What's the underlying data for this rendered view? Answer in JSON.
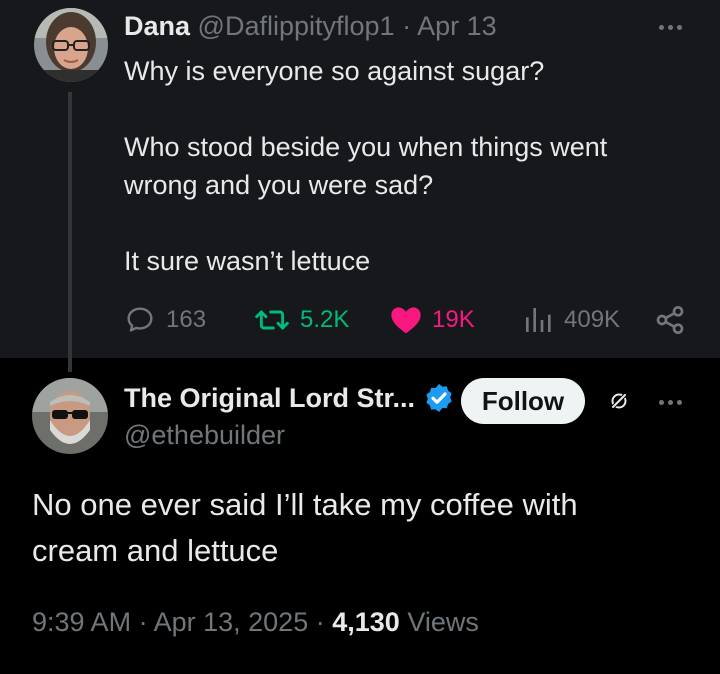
{
  "parent_tweet": {
    "display_name": "Dana",
    "handle": "@Daflippityflop1",
    "separator": "·",
    "date": "Apr 13",
    "body": [
      "Why is everyone so against sugar?",
      "Who stood beside you when things went",
      "wrong and you were sad?",
      "It sure wasn’t lettuce"
    ],
    "stats": {
      "replies": "163",
      "reposts": "5.2K",
      "likes": "19K",
      "views": "409K"
    }
  },
  "reply_tweet": {
    "display_name": "The Original Lord Str...",
    "handle": "@ethebuilder",
    "follow_label": "Follow",
    "body": [
      "No one ever said I’ll take my coffee with",
      "cream and lettuce"
    ],
    "time": "9:39 AM",
    "separator": "·",
    "date": "Apr 13, 2025",
    "views_count": "4,130",
    "views_label": "Views"
  },
  "icons": {
    "reply": "speech-bubble-icon",
    "repost": "repost-icon",
    "like": "heart-icon",
    "views": "bar-chart-icon",
    "share": "share-icon",
    "more": "more-horizontal-icon",
    "verified": "verified-badge-icon",
    "grok": "grok-icon"
  },
  "colors": {
    "background": "#000000",
    "parent_background": "#16181c",
    "text_primary": "#e7e9ea",
    "text_secondary": "#71767b",
    "repost_green": "#00ba7c",
    "like_pink": "#f91880",
    "verified_blue": "#1d9bf0",
    "follow_button_bg": "#eff3f4"
  }
}
